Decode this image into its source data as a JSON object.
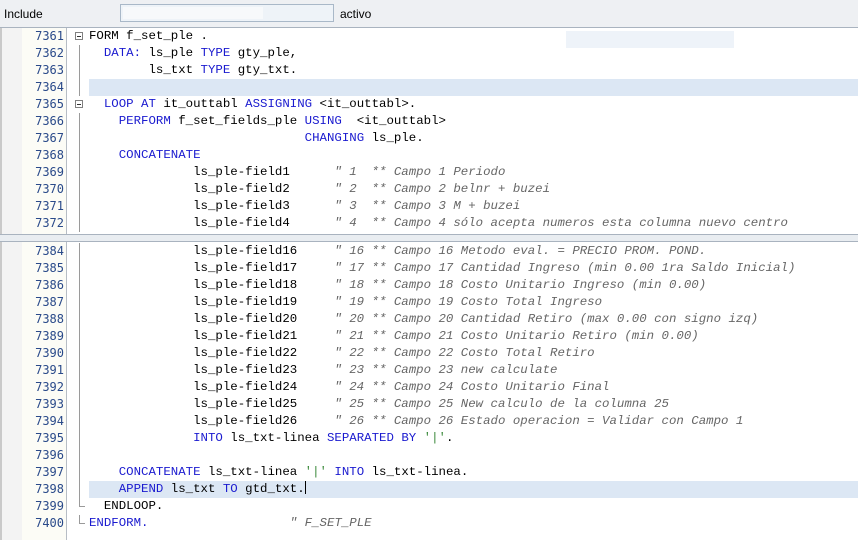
{
  "header": {
    "include_label": "Include",
    "status_label": "activo"
  },
  "pane_top": {
    "lines": [
      {
        "num": "7361",
        "fold": "box",
        "hl": false,
        "tokens": [
          [
            "kw0",
            "FORM f_set_ple ."
          ]
        ]
      },
      {
        "num": "7362",
        "fold": "line",
        "hl": false,
        "tokens": [
          [
            "t",
            "  "
          ],
          [
            "kw",
            "DATA:"
          ],
          [
            "t",
            " ls_ple "
          ],
          [
            "kw",
            "TYPE"
          ],
          [
            "t",
            " gty_ple,"
          ]
        ]
      },
      {
        "num": "7363",
        "fold": "line",
        "hl": false,
        "tokens": [
          [
            "t",
            "        ls_txt "
          ],
          [
            "kw",
            "TYPE"
          ],
          [
            "t",
            " gty_txt."
          ]
        ]
      },
      {
        "num": "7364",
        "fold": "line",
        "hl": true,
        "tokens": []
      },
      {
        "num": "7365",
        "fold": "box",
        "hl": false,
        "tokens": [
          [
            "t",
            "  "
          ],
          [
            "kw",
            "LOOP AT"
          ],
          [
            "t",
            " it_outtabl "
          ],
          [
            "kw",
            "ASSIGNING"
          ],
          [
            "t",
            " <it_outtabl>."
          ]
        ]
      },
      {
        "num": "7366",
        "fold": "line",
        "hl": false,
        "tokens": [
          [
            "t",
            "    "
          ],
          [
            "kw",
            "PERFORM"
          ],
          [
            "t",
            " f_set_fields_ple "
          ],
          [
            "kw",
            "USING"
          ],
          [
            "t",
            "  <it_outtabl>"
          ]
        ]
      },
      {
        "num": "7367",
        "fold": "line",
        "hl": false,
        "tokens": [
          [
            "t",
            "                             "
          ],
          [
            "kw",
            "CHANGING"
          ],
          [
            "t",
            " ls_ple."
          ]
        ]
      },
      {
        "num": "7368",
        "fold": "line",
        "hl": false,
        "tokens": [
          [
            "t",
            "    "
          ],
          [
            "kw",
            "CONCATENATE"
          ]
        ]
      },
      {
        "num": "7369",
        "fold": "line",
        "hl": false,
        "tokens": [
          [
            "t",
            "              ls_ple-field1      "
          ],
          [
            "cm",
            "\" 1  ** Campo 1 Periodo"
          ]
        ]
      },
      {
        "num": "7370",
        "fold": "line",
        "hl": false,
        "tokens": [
          [
            "t",
            "              ls_ple-field2      "
          ],
          [
            "cm",
            "\" 2  ** Campo 2 belnr + buzei"
          ]
        ]
      },
      {
        "num": "7371",
        "fold": "line",
        "hl": false,
        "tokens": [
          [
            "t",
            "              ls_ple-field3      "
          ],
          [
            "cm",
            "\" 3  ** Campo 3 M + buzei"
          ]
        ]
      },
      {
        "num": "7372",
        "fold": "line",
        "hl": false,
        "tokens": [
          [
            "t",
            "              ls_ple-field4      "
          ],
          [
            "cm",
            "\" 4  ** Campo 4 sólo acepta numeros esta columna nuevo centro"
          ]
        ]
      }
    ]
  },
  "pane_bottom": {
    "lines": [
      {
        "num": "7384",
        "fold": "line",
        "hl": false,
        "tokens": [
          [
            "t",
            "              ls_ple-field16     "
          ],
          [
            "cm",
            "\" 16 ** Campo 16 Metodo eval. = PRECIO PROM. POND."
          ]
        ]
      },
      {
        "num": "7385",
        "fold": "line",
        "hl": false,
        "tokens": [
          [
            "t",
            "              ls_ple-field17     "
          ],
          [
            "cm",
            "\" 17 ** Campo 17 Cantidad Ingreso (min 0.00 1ra Saldo Inicial)"
          ]
        ]
      },
      {
        "num": "7386",
        "fold": "line",
        "hl": false,
        "tokens": [
          [
            "t",
            "              ls_ple-field18     "
          ],
          [
            "cm",
            "\" 18 ** Campo 18 Costo Unitario Ingreso (min 0.00)"
          ]
        ]
      },
      {
        "num": "7387",
        "fold": "line",
        "hl": false,
        "tokens": [
          [
            "t",
            "              ls_ple-field19     "
          ],
          [
            "cm",
            "\" 19 ** Campo 19 Costo Total Ingreso"
          ]
        ]
      },
      {
        "num": "7388",
        "fold": "line",
        "hl": false,
        "tokens": [
          [
            "t",
            "              ls_ple-field20     "
          ],
          [
            "cm",
            "\" 20 ** Campo 20 Cantidad Retiro (max 0.00 con signo izq)"
          ]
        ]
      },
      {
        "num": "7389",
        "fold": "line",
        "hl": false,
        "tokens": [
          [
            "t",
            "              ls_ple-field21     "
          ],
          [
            "cm",
            "\" 21 ** Campo 21 Costo Unitario Retiro (min 0.00)"
          ]
        ]
      },
      {
        "num": "7390",
        "fold": "line",
        "hl": false,
        "tokens": [
          [
            "t",
            "              ls_ple-field22     "
          ],
          [
            "cm",
            "\" 22 ** Campo 22 Costo Total Retiro"
          ]
        ]
      },
      {
        "num": "7391",
        "fold": "line",
        "hl": false,
        "tokens": [
          [
            "t",
            "              ls_ple-field23     "
          ],
          [
            "cm",
            "\" 23 ** Campo 23 new calculate"
          ]
        ]
      },
      {
        "num": "7392",
        "fold": "line",
        "hl": false,
        "tokens": [
          [
            "t",
            "              ls_ple-field24     "
          ],
          [
            "cm",
            "\" 24 ** Campo 24 Costo Unitario Final"
          ]
        ]
      },
      {
        "num": "7393",
        "fold": "line",
        "hl": false,
        "tokens": [
          [
            "t",
            "              ls_ple-field25     "
          ],
          [
            "cm",
            "\" 25 ** Campo 25 New calculo de la columna 25"
          ]
        ]
      },
      {
        "num": "7394",
        "fold": "line",
        "hl": false,
        "tokens": [
          [
            "t",
            "              ls_ple-field26     "
          ],
          [
            "cm",
            "\" 26 ** Campo 26 Estado operacion = Validar con Campo 1"
          ]
        ]
      },
      {
        "num": "7395",
        "fold": "line",
        "hl": false,
        "tokens": [
          [
            "t",
            "              "
          ],
          [
            "kw",
            "INTO"
          ],
          [
            "t",
            " ls_txt-linea "
          ],
          [
            "kw",
            "SEPARATED BY"
          ],
          [
            "t",
            " "
          ],
          [
            "st2",
            "'|'"
          ],
          [
            "t",
            "."
          ]
        ]
      },
      {
        "num": "7396",
        "fold": "line",
        "hl": false,
        "tokens": []
      },
      {
        "num": "7397",
        "fold": "line",
        "hl": false,
        "tokens": [
          [
            "t",
            "    "
          ],
          [
            "kw",
            "CONCATENATE"
          ],
          [
            "t",
            " ls_txt-linea "
          ],
          [
            "st2",
            "'|'"
          ],
          [
            "t",
            " "
          ],
          [
            "kw",
            "INTO"
          ],
          [
            "t",
            " ls_txt-linea."
          ]
        ]
      },
      {
        "num": "7398",
        "fold": "line",
        "hl": true,
        "cursor": true,
        "tokens": [
          [
            "t",
            "    "
          ],
          [
            "kw",
            "APPEND"
          ],
          [
            "t",
            " ls_txt "
          ],
          [
            "kw",
            "TO"
          ],
          [
            "t",
            " gtd_txt."
          ]
        ]
      },
      {
        "num": "7399",
        "fold": "end",
        "hl": false,
        "tokens": [
          [
            "t",
            "  "
          ],
          [
            "t",
            "ENDLOOP."
          ]
        ]
      },
      {
        "num": "7400",
        "fold": "end",
        "hl": false,
        "tokens": [
          [
            "kw",
            "ENDFORM."
          ],
          [
            "t",
            "                   "
          ],
          [
            "cm",
            "\" F_SET_PLE"
          ]
        ]
      }
    ]
  },
  "colors": {
    "keyword": "#1a1acf",
    "comment": "#666666",
    "string": "#3b8a3b",
    "highlight": "#dce7f4",
    "line_number": "#2a4a8a"
  }
}
